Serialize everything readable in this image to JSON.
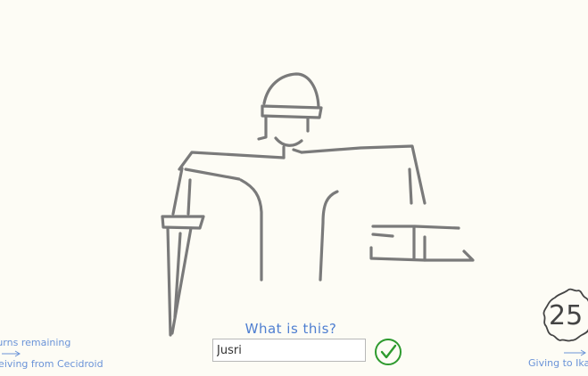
{
  "game": {
    "prompt": "What is this?",
    "guess_value": "Jusri",
    "timer": "25",
    "turns_label": "turns remaining",
    "receiving_label": "ceiving from Cecidroid",
    "giving_label": "Giving to Ikare"
  },
  "icons": {
    "submit": "check-circle-icon",
    "arrow": "arrow-right-icon",
    "timer": "scribble-circle-icon"
  },
  "colors": {
    "background": "#fdfcf5",
    "ink": "#7a7a7a",
    "accent": "#4f7fd1",
    "check": "#2e9a2e"
  }
}
